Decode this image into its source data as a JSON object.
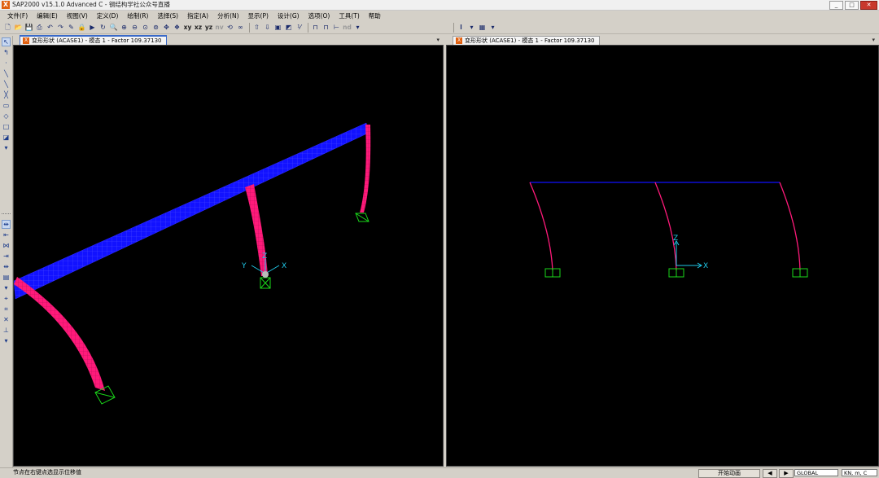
{
  "window": {
    "app_icon": "X",
    "title": "SAP2000 v15.1.0 Advanced C - 钢结构学社公众号直播",
    "minimize": "_",
    "maximize": "□",
    "close": "✕"
  },
  "menu": [
    "文件(F)",
    "编辑(E)",
    "视图(V)",
    "定义(D)",
    "绘制(R)",
    "选择(S)",
    "指定(A)",
    "分析(N)",
    "显示(P)",
    "设计(G)",
    "选项(O)",
    "工具(T)",
    "帮助"
  ],
  "toolbar": {
    "view_xy": "xy",
    "view_xz": "xz",
    "view_yz": "yz",
    "view_nv": "nv",
    "label_nd": "nd"
  },
  "left_pane": {
    "tab_title": "变形形状 (ACASE1) - 模态 1 - Factor 109.37130",
    "axes": {
      "x": "X",
      "y": "Y",
      "z": "Z"
    }
  },
  "right_pane": {
    "tab_title": "变形形状 (ACASE1) - 模态 1 - Factor 109.37130",
    "axes": {
      "x": "X",
      "z": "Z"
    }
  },
  "status": {
    "message": "节点在右键点选显示位移值",
    "animate_button": "开始动画",
    "coord_system": "GLOBAL",
    "units": "KN, m, C"
  },
  "colors": {
    "beam_blue": "#1010ff",
    "column_pink": "#ff1a7a",
    "support_green": "#1ad81a",
    "axis_cyan": "#20c8e8",
    "background": "#000000"
  }
}
